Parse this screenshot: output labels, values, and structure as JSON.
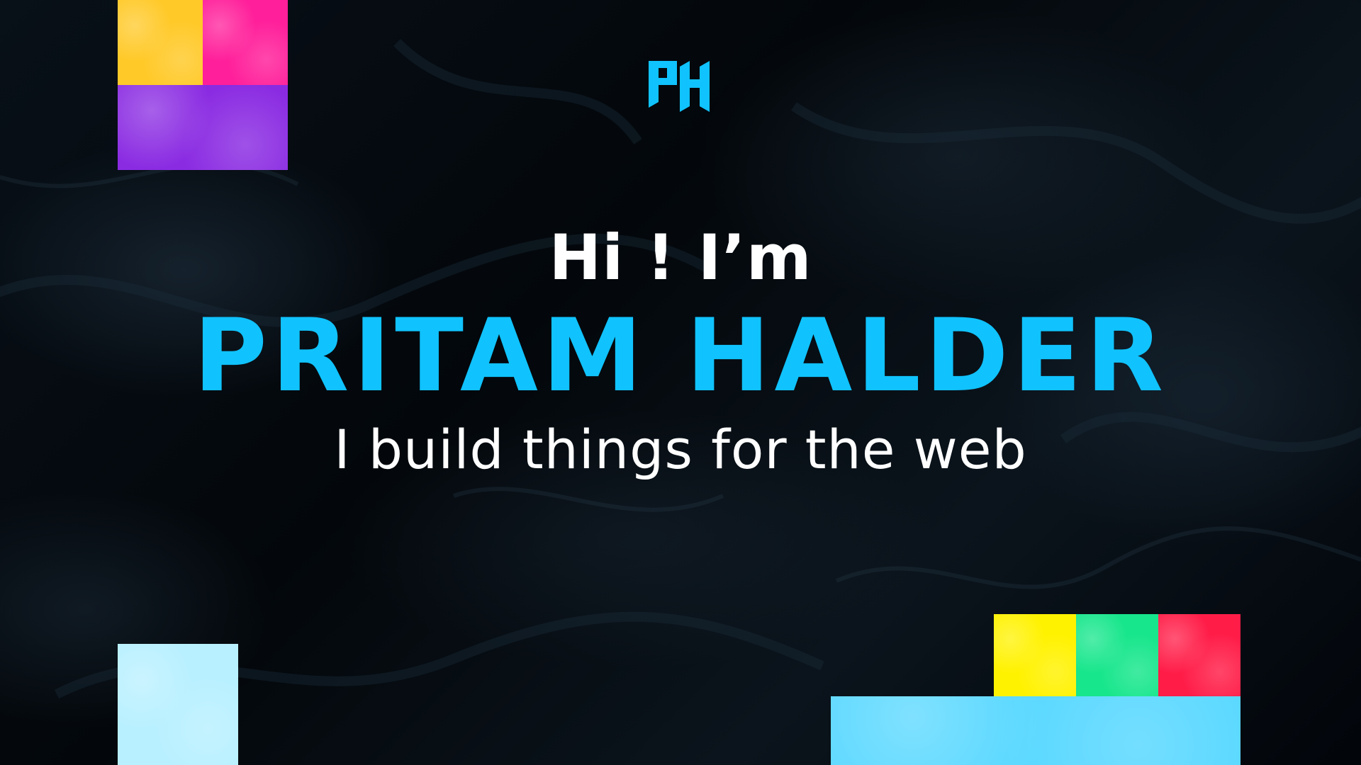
{
  "hero": {
    "greeting": "Hi ! I’m",
    "name": "PRITAM HALDER",
    "tagline": "I build things for the web"
  },
  "logo": {
    "letters": "PH",
    "color": "#10c3ff"
  },
  "colors": {
    "accent": "#10c3ff",
    "text": "#ffffff",
    "background": "#05090e",
    "swatch_yellow_soft": "#ffc928",
    "swatch_pink": "#ff1f9a",
    "swatch_purple": "#8a2be2",
    "swatch_light_blue": "#b8f0ff",
    "swatch_yellow": "#fff200",
    "swatch_green": "#17e68c",
    "swatch_red": "#ff1d48",
    "swatch_sky": "#55d7ff"
  }
}
